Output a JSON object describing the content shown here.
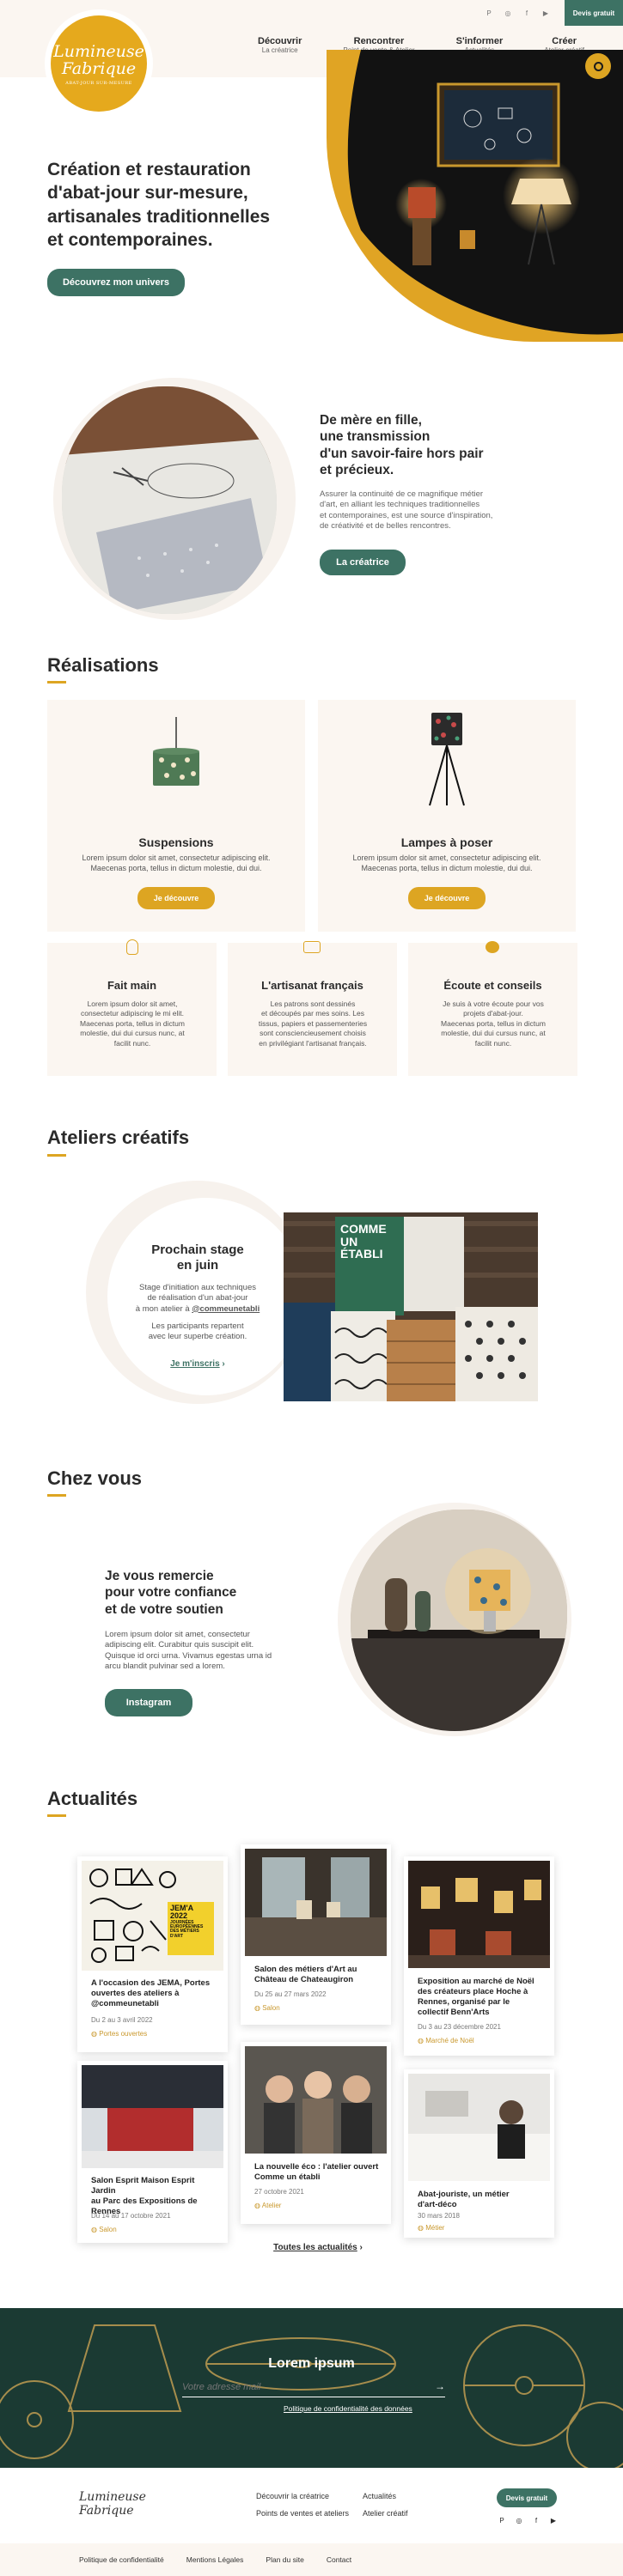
{
  "header": {
    "logo_line1": "Lumineuse",
    "logo_line2": "Fabrique",
    "logo_tagline": "ABAT-JOUR SUR-MESURE",
    "nav": [
      {
        "label": "Découvrir",
        "sub": "La créatrice"
      },
      {
        "label": "Rencontrer",
        "sub": "Point de vente & Atelier"
      },
      {
        "label": "S'informer",
        "sub": "Actualités"
      },
      {
        "label": "Créer",
        "sub": "Atelier créatif"
      }
    ],
    "devis_label": "Devis gratuit"
  },
  "hero": {
    "title_line1": "Création et restauration",
    "title_line2": "d'abat-jour sur-mesure,",
    "title_line3": "artisanales traditionnelles",
    "title_line4": "et contemporaines.",
    "cta": "Découvrez mon univers"
  },
  "mere": {
    "title_line1": "De mère en fille,",
    "title_line2": "une transmission",
    "title_line3": "d'un savoir-faire hors pair",
    "title_line4": "et précieux.",
    "text_line1": "Assurer la continuité de ce magnifique métier",
    "text_line2": "d'art, en alliant les techniques traditionnelles",
    "text_line3": "et contemporaines, est une source d'inspiration,",
    "text_line4": "de créativité et de belles rencontres.",
    "cta": "La créatrice"
  },
  "realisations": {
    "title": "Réalisations",
    "cards": [
      {
        "title": "Suspensions",
        "text_line1": "Lorem ipsum dolor sit amet, consectetur adipiscing elit.",
        "text_line2": "Maecenas porta, tellus in dictum molestie, dui dui.",
        "cta": "Je découvre"
      },
      {
        "title": "Lampes à poser",
        "text_line1": "Lorem ipsum dolor sit amet, consectetur adipiscing elit.",
        "text_line2": "Maecenas porta, tellus in dictum molestie, dui dui.",
        "cta": "Je découvre"
      }
    ],
    "features": [
      {
        "title": "Fait main",
        "text_line1": "Lorem ipsum dolor sit amet,",
        "text_line2": "consectetur adipiscing le mi elit.",
        "text_line3": "Maecenas porta, tellus in dictum",
        "text_line4": "molestie, dui dui cursus nunc, at",
        "text_line5": "facilit nunc."
      },
      {
        "title": "L'artisanat français",
        "text_line1": "Les patrons sont dessinés",
        "text_line2": "et découpés par mes soins. Les",
        "text_line3": "tissus, papiers et passementeries",
        "text_line4": "sont consciencieusement choisis",
        "text_line5": "en privilégiant l'artisanat français."
      },
      {
        "title": "Écoute et conseils",
        "text_line1": "Je suis à votre écoute pour vos",
        "text_line2": "projets d'abat-jour.",
        "text_line3": "Maecenas porta, tellus in dictum",
        "text_line4": "molestie, dui dui cursus nunc, at",
        "text_line5": "facilit nunc."
      }
    ]
  },
  "ateliers": {
    "title": "Ateliers créatifs",
    "stage_title_line1": "Prochain stage",
    "stage_title_line2": "en juin",
    "text_line1": "Stage d'initiation aux techniques",
    "text_line2": "de réalisation d'un abat-jour",
    "text_line3": "à mon atelier à",
    "text_handle": "@commeunetabli",
    "text_line4": "Les participants repartent",
    "text_line5": "avec leur superbe création.",
    "link": "Je m'inscris",
    "sign_line1": "COMME",
    "sign_line2": "UN",
    "sign_line3": "ÉTABLI"
  },
  "chezvous": {
    "title": "Chez vous",
    "heading_line1": "Je vous remercie",
    "heading_line2": "pour votre confiance",
    "heading_line3": "et de votre soutien",
    "text_line1": "Lorem ipsum dolor sit amet, consectetur",
    "text_line2": "adipiscing elit. Curabitur quis suscipit elit.",
    "text_line3": "Quisque id orci urna. Vivamus egestas urna id",
    "text_line4": "arcu blandit pulvinar sed a lorem.",
    "cta": "Instagram"
  },
  "actualites": {
    "title": "Actualités",
    "items": [
      {
        "title_line1": "A l'occasion des JEMA, Portes",
        "title_line2": "ouvertes des ateliers à",
        "title_line3": "@commeunetabli",
        "date": "Du 2 au 3 avril 2022",
        "cat": "Portes ouvertes"
      },
      {
        "title_line1": "Salon des métiers d'Art au",
        "title_line2": "Château de Chateaugiron",
        "title_line3": "",
        "date": "Du 25 au 27 mars 2022",
        "cat": "Salon"
      },
      {
        "title_line1": "Exposition au marché de Noël",
        "title_line2": "des créateurs place Hoche à",
        "title_line3": "Rennes, organisé par le",
        "title_line4": "collectif Benn'Arts",
        "date": "Du 3 au 23 décembre 2021",
        "cat": "Marché de Noël"
      },
      {
        "title_line1": "Salon Esprit Maison Esprit Jardin",
        "title_line2": "au Parc des Expositions de",
        "title_line3": "Rennes",
        "date": "Du 14 au 17 octobre 2021",
        "cat": "Salon"
      },
      {
        "title_line1": "La nouvelle éco : l'atelier ouvert",
        "title_line2": "Comme un établi",
        "title_line3": "",
        "date": "27 octobre 2021",
        "cat": "Atelier"
      },
      {
        "title_line1": "Abat-jouriste, un métier",
        "title_line2": "d'art-déco",
        "title_line3": "",
        "date": "30 mars 2018",
        "cat": "Métier"
      }
    ],
    "all_link": "Toutes les actualités",
    "poster_text_line1": "JEM'A",
    "poster_text_line2": "2022",
    "poster_text_line3": "JOURNÉES",
    "poster_text_line4": "EUROPÉENNES",
    "poster_text_line5": "DES MÉTIERS",
    "poster_text_line6": "D'ART"
  },
  "newsletter": {
    "title": "Lorem ipsum",
    "placeholder": "Votre adresse mail",
    "privacy": "Politique de confidentialité des données"
  },
  "footer": {
    "logo_line1": "Lumineuse",
    "logo_line2": "Fabrique",
    "links": [
      "Découvrir la créatrice",
      "Actualités",
      "Points de ventes et ateliers",
      "Atelier créatif"
    ],
    "devis_label": "Devis gratuit",
    "bottom_links": [
      "Politique de confidentialité",
      "Mentions Légales",
      "Plan du site",
      "Contact"
    ]
  }
}
